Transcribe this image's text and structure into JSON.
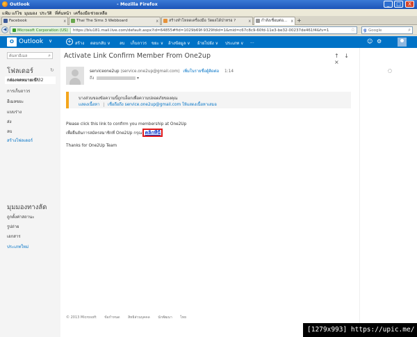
{
  "window": {
    "title": "Outlook",
    "app_title": "- Mozilla Firefox",
    "minimize": "_",
    "maximize": "□",
    "close": "X"
  },
  "menu": [
    "แฟ้ม",
    "แก้ไข",
    "มุมมอง",
    "ประวัติ",
    "ที่คั่นหน้า",
    "เครื่องมือ",
    "ช่วยเหลือ"
  ],
  "tabs": [
    {
      "label": "Facebook",
      "fav_color": "#3b5998",
      "close": "x"
    },
    {
      "label": "Thai The Sims 3 Webboard",
      "fav_color": "#6aa84f",
      "close": "x"
    },
    {
      "label": "สร้างทำโหลดเครื่องมือ วัดผลได้ป่าหรอ ?",
      "fav_color": "#e69138",
      "close": "x"
    },
    {
      "label": "กำลังเชื่อมต่อ...",
      "fav_color": "#999999",
      "close": "x"
    }
  ],
  "new_tab": "+",
  "navigation": {
    "back": "◀",
    "site_identity": "Microsoft Corporation (US)",
    "url": "https://blu181.mail.live.com/default.aspx?id=64855#fid=1029b69f-9329fdid=1&mid=c67c8c9-60fd-11e3-be32-00237de461f4&fv=1",
    "bookmark_star": "☆"
  },
  "browser_search": {
    "engine_badge": "g",
    "placeholder": "Google",
    "search_icon": "⌕"
  },
  "outlook_header": {
    "logo_text": "O",
    "app_name": "Outlook",
    "app_switch": "∨",
    "new_plus": "+",
    "new_label": "สร้าง",
    "commands": [
      "ตอบกลับ ∨",
      "ลบ",
      "เก็บถาวร",
      "ขยะ ∨",
      "ล้างข้อมูล ∨",
      "ย้ายไปยัง ∨",
      "ประเภท ∨",
      "..."
    ],
    "settings_icon": "⚙",
    "chat_icon": "☺"
  },
  "left_pane": {
    "search_placeholder": "ค้นหาอีเมล",
    "search_icon": "⌕",
    "folders_title": "โฟลเดอร์",
    "refresh_icon": "↻",
    "folders": [
      {
        "label": "กล่องจดหมายเข้า",
        "count": "732"
      },
      {
        "label": "การเก็บถาวร",
        "count": ""
      },
      {
        "label": "อีเมลขยะ",
        "count": ""
      },
      {
        "label": "แบบร่าง",
        "count": ""
      },
      {
        "label": "ส่ง",
        "count": ""
      },
      {
        "label": "ลบ",
        "count": ""
      }
    ],
    "new_folder": "สร้างโฟลเดอร์",
    "quick_views_title": "มุมมองทางลัด",
    "quick_views": [
      "ถูกตั้งค่าสถานะ",
      "รูปถ่าย",
      "เอกสาร"
    ],
    "new_category": "ประเภทใหม่"
  },
  "message": {
    "subject": "Activate Link Confirm Member From One2up",
    "toolbar": {
      "up": "↑",
      "down": "↓",
      "close": "×"
    },
    "sender_name": "serviceone2up",
    "sender_email": "(service.one2up@gmail.com)",
    "add_contact": "เพิ่มในรายชื่อผู้ติดต่อ",
    "time": "1:14",
    "to_label": "ถึง",
    "to_more": "▾",
    "notice_text": "บางส่วนของข้อความนี้ถูกบล็อกเพื่อความปลอดภัยของคุณ",
    "notice_show": "แสดงเนื้อหา",
    "notice_sep": "|",
    "notice_trust": "เชื่อถือถึง service.one2up@gmail.com ให้แสดงเนื้อหาเสมอ",
    "body_line1": "Please click this link to confirm you membership at One2Up",
    "body_line2_prefix": "เพื่อยืนยันการสมัครสมาชิกที่ One2Up กรุณา",
    "confirm_link": "คลิกที่นี่",
    "signoff": "Thanks for One2Up Team"
  },
  "footer": [
    "© 2013 Microsoft",
    "ข้อกำหนด",
    "สิทธิส่วนบุคคล",
    "นักพัฒนา",
    "ไทย"
  ],
  "watermark": "[1279x993] https://upic.me/"
}
